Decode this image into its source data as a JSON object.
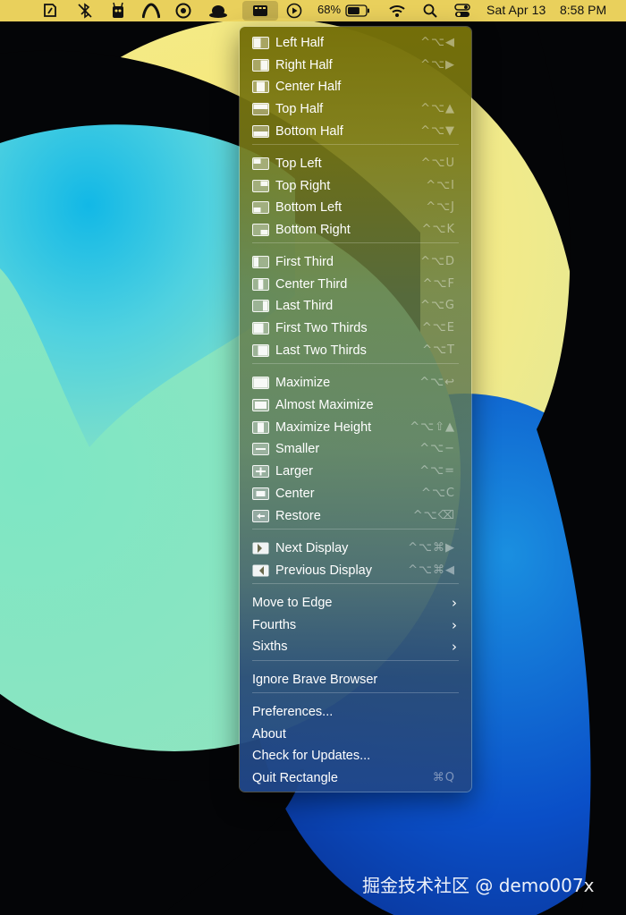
{
  "menubar": {
    "battery_percent": "68%",
    "battery_level": 0.68,
    "date": "Sat Apr 13",
    "time": "8:58 PM",
    "icons": [
      "pen-icon",
      "bluetooth-crossed-icon",
      "robot-icon",
      "arc-icon",
      "at-icon",
      "hat-icon",
      "rectangle-app-icon",
      "play-circle-icon",
      "battery-icon",
      "wifi-icon",
      "search-icon",
      "control-center-icon"
    ]
  },
  "menu": {
    "items": [
      {
        "label": "Left Half",
        "shortcut": "^⌥◀",
        "icon": "left-half-icon"
      },
      {
        "label": "Right Half",
        "shortcut": "^⌥▶",
        "icon": "right-half-icon"
      },
      {
        "label": "Center Half",
        "shortcut": "",
        "icon": "center-half-icon"
      },
      {
        "label": "Top Half",
        "shortcut": "^⌥▲",
        "icon": "top-half-icon"
      },
      {
        "label": "Bottom Half",
        "shortcut": "^⌥▼",
        "icon": "bottom-half-icon"
      },
      {
        "label": "Top Left",
        "shortcut": "^⌥U",
        "icon": "top-left-icon"
      },
      {
        "label": "Top Right",
        "shortcut": "^⌥I",
        "icon": "top-right-icon"
      },
      {
        "label": "Bottom Left",
        "shortcut": "^⌥J",
        "icon": "bottom-left-icon"
      },
      {
        "label": "Bottom Right",
        "shortcut": "^⌥K",
        "icon": "bottom-right-icon"
      },
      {
        "label": "First Third",
        "shortcut": "^⌥D",
        "icon": "first-third-icon"
      },
      {
        "label": "Center Third",
        "shortcut": "^⌥F",
        "icon": "center-third-icon"
      },
      {
        "label": "Last Third",
        "shortcut": "^⌥G",
        "icon": "last-third-icon"
      },
      {
        "label": "First Two Thirds",
        "shortcut": "^⌥E",
        "icon": "first-two-thirds-icon"
      },
      {
        "label": "Last Two Thirds",
        "shortcut": "^⌥T",
        "icon": "last-two-thirds-icon"
      },
      {
        "label": "Maximize",
        "shortcut": "^⌥↩",
        "icon": "maximize-icon"
      },
      {
        "label": "Almost Maximize",
        "shortcut": "",
        "icon": "almost-maximize-icon"
      },
      {
        "label": "Maximize Height",
        "shortcut": "^⌥⇧▲",
        "icon": "maximize-height-icon"
      },
      {
        "label": "Smaller",
        "shortcut": "^⌥−",
        "icon": "smaller-icon"
      },
      {
        "label": "Larger",
        "shortcut": "^⌥=",
        "icon": "larger-icon"
      },
      {
        "label": "Center",
        "shortcut": "^⌥C",
        "icon": "center-icon"
      },
      {
        "label": "Restore",
        "shortcut": "^⌥⌫",
        "icon": "restore-icon"
      },
      {
        "label": "Next Display",
        "shortcut": "^⌥⌘▶",
        "icon": "next-display-icon"
      },
      {
        "label": "Previous Display",
        "shortcut": "^⌥⌘◀",
        "icon": "previous-display-icon"
      },
      {
        "label": "Move to Edge",
        "submenu": true
      },
      {
        "label": "Fourths",
        "submenu": true
      },
      {
        "label": "Sixths",
        "submenu": true
      },
      {
        "label": "Ignore Brave Browser"
      },
      {
        "label": "Preferences..."
      },
      {
        "label": "About"
      },
      {
        "label": "Check for Updates..."
      },
      {
        "label": "Quit Rectangle",
        "shortcut": "⌘Q"
      }
    ]
  },
  "watermark": "掘金技术社区 @ demo007x"
}
